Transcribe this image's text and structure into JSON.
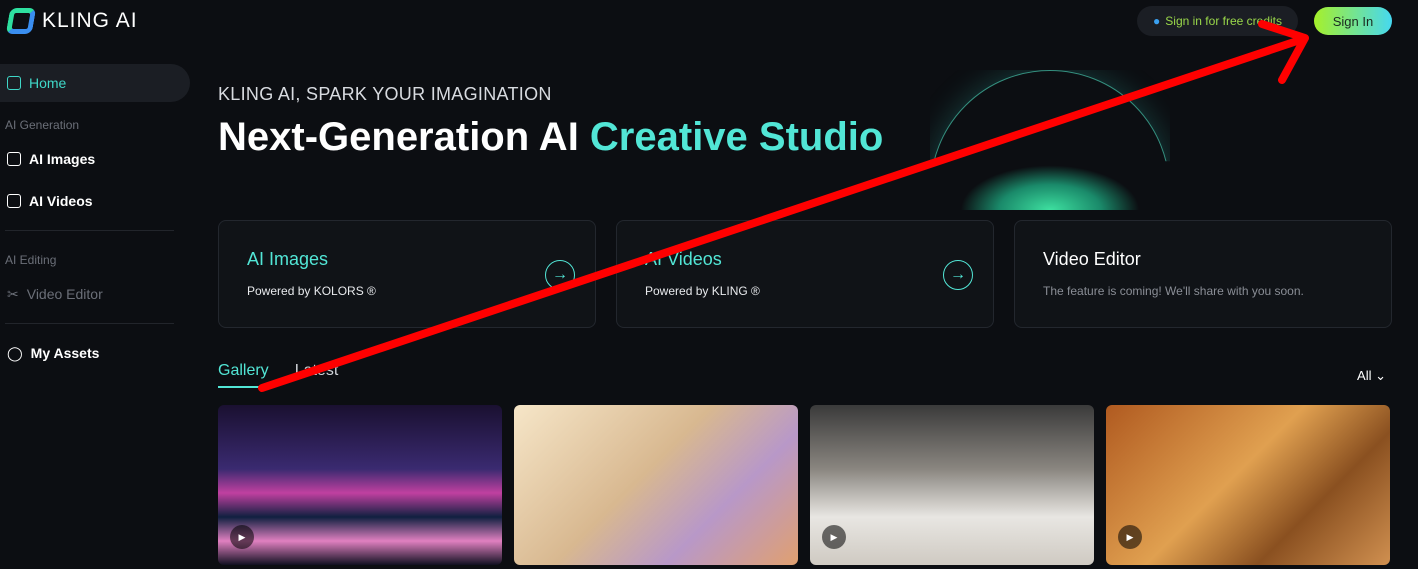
{
  "brand": {
    "name": "KLING AI"
  },
  "header": {
    "credits_label": "Sign in for free credits",
    "signin_label": "Sign In"
  },
  "sidebar": {
    "home": "Home",
    "section_generation": "AI Generation",
    "ai_images": "AI Images",
    "ai_videos": "AI Videos",
    "section_editing": "AI Editing",
    "video_editor": "Video Editor",
    "my_assets": "My Assets"
  },
  "hero": {
    "subtitle": "KLING AI, SPARK YOUR IMAGINATION",
    "title_main": "Next-Generation AI ",
    "title_accent": "Creative Studio"
  },
  "cards": [
    {
      "title": "AI Images",
      "desc": "Powered by KOLORS ®"
    },
    {
      "title": "AI Videos",
      "desc": "Powered by KLING ®"
    },
    {
      "title": "Video Editor",
      "desc": "The feature is coming! We'll share with you soon."
    }
  ],
  "gallery": {
    "tabs": [
      "Gallery",
      "Latest"
    ],
    "filter": "All ⌄",
    "items": [
      {
        "type": "video"
      },
      {
        "type": "image"
      },
      {
        "type": "video"
      },
      {
        "type": "video"
      }
    ]
  },
  "colors": {
    "accent": "#52e6d6",
    "annotation": "#ff0000"
  }
}
